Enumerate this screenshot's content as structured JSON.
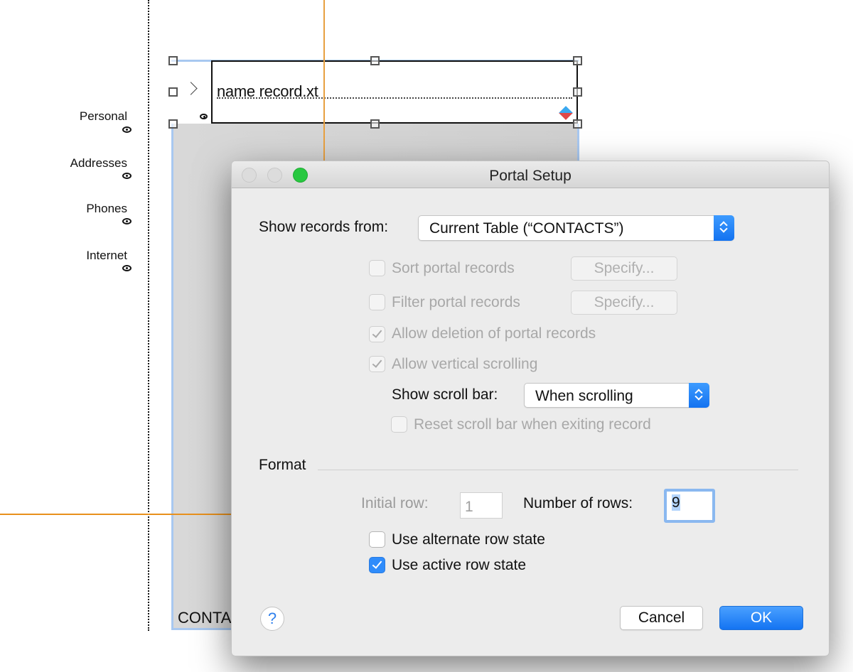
{
  "layout_canvas": {
    "tab_labels": [
      {
        "label": "Personal",
        "icon": "eye-icon"
      },
      {
        "label": "Addresses",
        "icon": "eye-icon"
      },
      {
        "label": "Phones",
        "icon": "eye-icon"
      },
      {
        "label": "Internet",
        "icon": "eye-icon"
      }
    ],
    "portal": {
      "field_text": "name record.xt",
      "expand_icon": "chevron-right-icon",
      "visibility_icon": "eye-icon",
      "conditional_icon": "diamond-icon",
      "table_label": "CONTA"
    },
    "guide_color": "#e8901c",
    "selection_color": "#a8c8f0"
  },
  "dialog": {
    "title": "Portal Setup",
    "window_controls": [
      "close",
      "minimize",
      "zoom"
    ],
    "show_records_from": {
      "label": "Show records from:",
      "value": "Current Table (“CONTACTS”)"
    },
    "options": [
      {
        "label": "Sort portal records",
        "checked": false,
        "enabled": false,
        "button": "Specify..."
      },
      {
        "label": "Filter portal records",
        "checked": false,
        "enabled": false,
        "button": "Specify..."
      },
      {
        "label": "Allow deletion of portal records",
        "checked": true,
        "enabled": false
      },
      {
        "label": "Allow vertical scrolling",
        "checked": true,
        "enabled": false
      }
    ],
    "show_scroll_bar": {
      "label": "Show scroll bar:",
      "value": "When scrolling"
    },
    "reset_scroll_bar": {
      "label": "Reset scroll bar when exiting record",
      "checked": false,
      "enabled": false
    },
    "format": {
      "heading": "Format",
      "initial_row_label": "Initial row:",
      "initial_row_value": "1",
      "number_of_rows_label": "Number of rows:",
      "number_of_rows_value": "9",
      "alternate_row_state": {
        "label": "Use alternate row state",
        "checked": false
      },
      "active_row_state": {
        "label": "Use active row state",
        "checked": true
      }
    },
    "help_label": "?",
    "cancel_label": "Cancel",
    "ok_label": "OK",
    "accent_color": "#1c7cf4"
  }
}
